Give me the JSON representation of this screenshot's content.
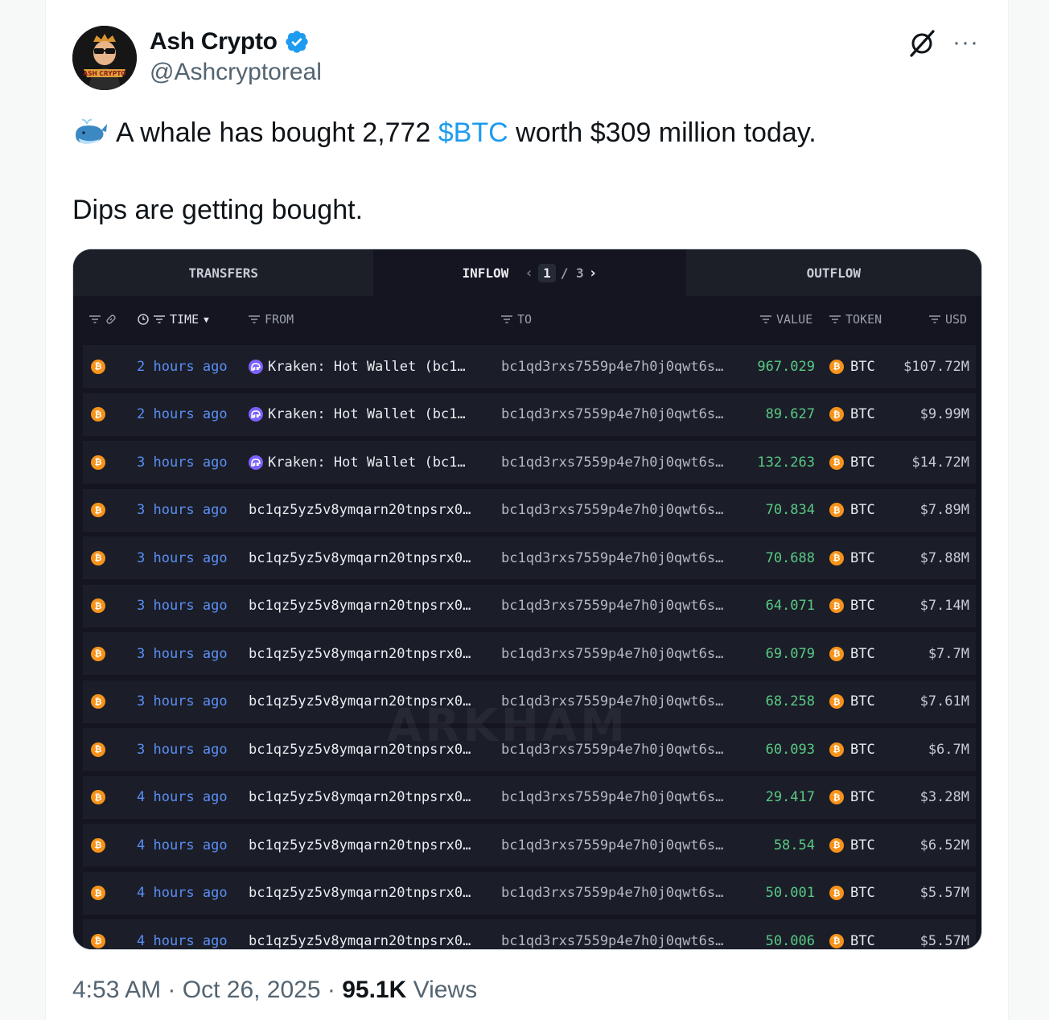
{
  "author": {
    "name": "Ash Crypto",
    "handle": "@Ashcryptoreal",
    "avatar_text": "ASH CRYPTO",
    "verified": true
  },
  "tweet": {
    "emoji": "whale-emoji",
    "text_before": "A whale has bought 2,772 ",
    "cashtag": "$BTC",
    "text_after": " worth $309 million today.",
    "line2": "Dips are getting bought."
  },
  "media": {
    "tabs": [
      {
        "label": "TRANSFERS",
        "active": false
      },
      {
        "label": "INFLOW",
        "active": true,
        "page_current": "1",
        "page_total": "/ 3"
      },
      {
        "label": "OUTFLOW",
        "active": false
      }
    ],
    "columns": {
      "time": "TIME",
      "from": "FROM",
      "to": "TO",
      "value": "VALUE",
      "token": "TOKEN",
      "usd": "USD"
    },
    "watermark": "ARKHAM",
    "rows": [
      {
        "time": "2 hours ago",
        "from": "Kraken: Hot Wallet (bc1…",
        "from_entity": true,
        "to": "bc1qd3rxs7559p4e7h0j0qwt6s…",
        "value": "967.029",
        "token": "BTC",
        "usd": "$107.72M"
      },
      {
        "time": "2 hours ago",
        "from": "Kraken: Hot Wallet (bc1…",
        "from_entity": true,
        "to": "bc1qd3rxs7559p4e7h0j0qwt6s…",
        "value": "89.627",
        "token": "BTC",
        "usd": "$9.99M"
      },
      {
        "time": "3 hours ago",
        "from": "Kraken: Hot Wallet (bc1…",
        "from_entity": true,
        "to": "bc1qd3rxs7559p4e7h0j0qwt6s…",
        "value": "132.263",
        "token": "BTC",
        "usd": "$14.72M"
      },
      {
        "time": "3 hours ago",
        "from": "bc1qz5yz5v8ymqarn20tnpsrx0…",
        "from_entity": false,
        "to": "bc1qd3rxs7559p4e7h0j0qwt6s…",
        "value": "70.834",
        "token": "BTC",
        "usd": "$7.89M"
      },
      {
        "time": "3 hours ago",
        "from": "bc1qz5yz5v8ymqarn20tnpsrx0…",
        "from_entity": false,
        "to": "bc1qd3rxs7559p4e7h0j0qwt6s…",
        "value": "70.688",
        "token": "BTC",
        "usd": "$7.88M"
      },
      {
        "time": "3 hours ago",
        "from": "bc1qz5yz5v8ymqarn20tnpsrx0…",
        "from_entity": false,
        "to": "bc1qd3rxs7559p4e7h0j0qwt6s…",
        "value": "64.071",
        "token": "BTC",
        "usd": "$7.14M"
      },
      {
        "time": "3 hours ago",
        "from": "bc1qz5yz5v8ymqarn20tnpsrx0…",
        "from_entity": false,
        "to": "bc1qd3rxs7559p4e7h0j0qwt6s…",
        "value": "69.079",
        "token": "BTC",
        "usd": "$7.7M"
      },
      {
        "time": "3 hours ago",
        "from": "bc1qz5yz5v8ymqarn20tnpsrx0…",
        "from_entity": false,
        "to": "bc1qd3rxs7559p4e7h0j0qwt6s…",
        "value": "68.258",
        "token": "BTC",
        "usd": "$7.61M"
      },
      {
        "time": "3 hours ago",
        "from": "bc1qz5yz5v8ymqarn20tnpsrx0…",
        "from_entity": false,
        "to": "bc1qd3rxs7559p4e7h0j0qwt6s…",
        "value": "60.093",
        "token": "BTC",
        "usd": "$6.7M"
      },
      {
        "time": "4 hours ago",
        "from": "bc1qz5yz5v8ymqarn20tnpsrx0…",
        "from_entity": false,
        "to": "bc1qd3rxs7559p4e7h0j0qwt6s…",
        "value": "29.417",
        "token": "BTC",
        "usd": "$3.28M"
      },
      {
        "time": "4 hours ago",
        "from": "bc1qz5yz5v8ymqarn20tnpsrx0…",
        "from_entity": false,
        "to": "bc1qd3rxs7559p4e7h0j0qwt6s…",
        "value": "58.54",
        "token": "BTC",
        "usd": "$6.52M"
      },
      {
        "time": "4 hours ago",
        "from": "bc1qz5yz5v8ymqarn20tnpsrx0…",
        "from_entity": false,
        "to": "bc1qd3rxs7559p4e7h0j0qwt6s…",
        "value": "50.001",
        "token": "BTC",
        "usd": "$5.57M"
      },
      {
        "time": "4 hours ago",
        "from": "bc1qz5yz5v8ymqarn20tnpsrx0…",
        "from_entity": false,
        "to": "bc1qd3rxs7559p4e7h0j0qwt6s…",
        "value": "50.006",
        "token": "BTC",
        "usd": "$5.57M"
      }
    ]
  },
  "meta": {
    "time": "4:53 AM",
    "sep1": " · ",
    "date": "Oct 26, 2025",
    "sep2": " · ",
    "views_count": "95.1K",
    "views_label": " Views"
  },
  "colors": {
    "cashtag": "#1d9bf0",
    "verified": "#1d9bf0",
    "btc": "#f7931a",
    "time_link": "#5b8ef5",
    "value_green": "#59c985"
  }
}
